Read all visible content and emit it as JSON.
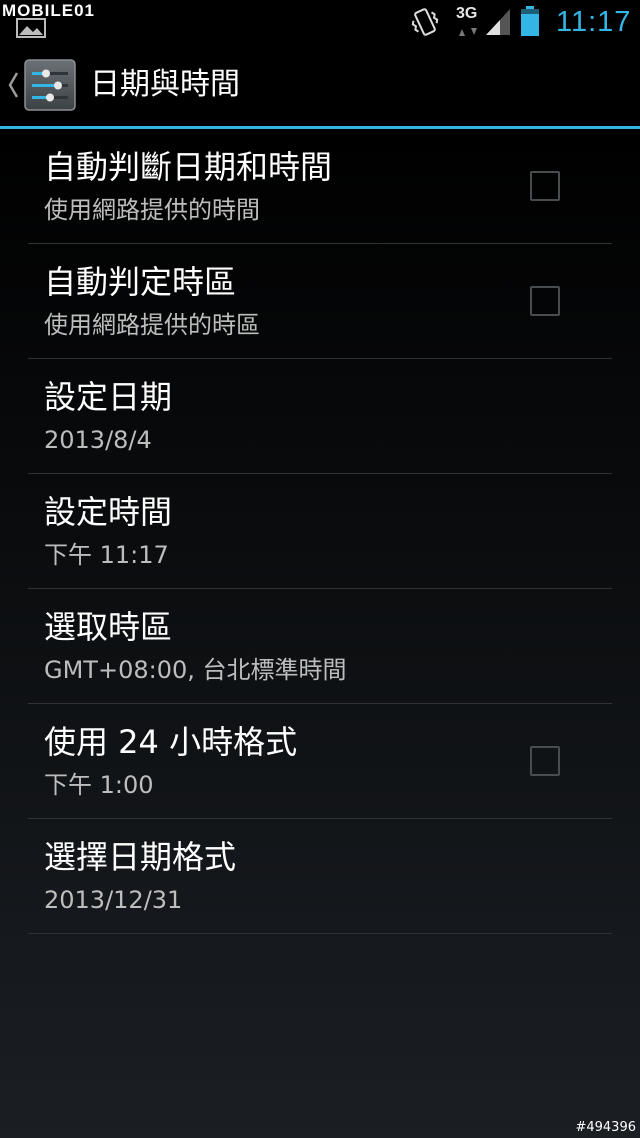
{
  "status_bar": {
    "watermark_brand": "MOBILE01",
    "network_type": "3G",
    "time": "11:17",
    "icons": [
      "gallery-notification-icon",
      "vibrate-icon",
      "data-arrows-icon",
      "signal-icon",
      "battery-icon"
    ]
  },
  "action_bar": {
    "title": "日期與時間",
    "up_icon": "chevron-left-icon",
    "app_icon": "settings-sliders-icon"
  },
  "preferences": [
    {
      "title": "自動判斷日期和時間",
      "summary": "使用網路提供的時間",
      "has_checkbox": true,
      "checked": false
    },
    {
      "title": "自動判定時區",
      "summary": "使用網路提供的時區",
      "has_checkbox": true,
      "checked": false
    },
    {
      "title": "設定日期",
      "summary": "2013/8/4",
      "has_checkbox": false
    },
    {
      "title": "設定時間",
      "summary": "下午 11:17",
      "has_checkbox": false
    },
    {
      "title": "選取時區",
      "summary": "GMT+08:00, 台北標準時間",
      "has_checkbox": false
    },
    {
      "title": "使用 24 小時格式",
      "summary": "下午 1:00",
      "has_checkbox": true,
      "checked": false
    },
    {
      "title": "選擇日期格式",
      "summary": "2013/12/31",
      "has_checkbox": false
    }
  ],
  "watermark_id": "#494396",
  "colors": {
    "accent": "#33b5e5",
    "background": "#000000",
    "divider": "#2e3236",
    "summary_text": "#bdbdbd"
  }
}
